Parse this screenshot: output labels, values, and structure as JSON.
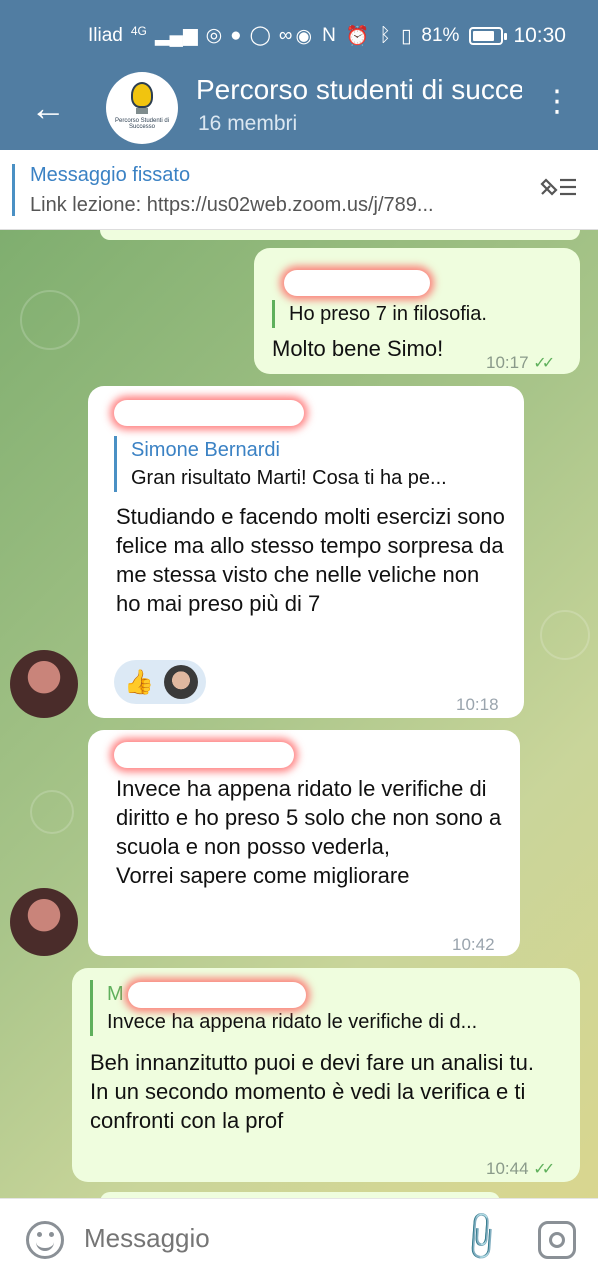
{
  "statusbar": {
    "carrier": "Iliad",
    "network": "4G",
    "battery": "81%",
    "battery_level": 0.81,
    "time": "10:30"
  },
  "header": {
    "title": "Percorso studenti di successo",
    "subtitle": "16 membri",
    "avatar_text": "Percorso Studenti di Successo"
  },
  "pinned": {
    "label": "Messaggio fissato",
    "text": "Link lezione:  https://us02web.zoom.us/j/789..."
  },
  "messages": [
    {
      "quote_text": "Ho preso 7 in filosofia.",
      "text": "Molto bene Simo!",
      "time": "10:17"
    },
    {
      "quote_name": "Simone Bernardi",
      "quote_text": "Gran risultato Marti! Cosa ti ha pe...",
      "text": "Studiando e facendo molti esercizi sono felice ma allo stesso tempo sorpresa da me stessa visto che nelle veliche non ho mai preso più di 7",
      "time": "10:18",
      "reaction": "👍"
    },
    {
      "text": "Invece ha appena ridato le verifiche di diritto e ho preso 5 solo che non sono a scuola e non posso vederla,\nVorrei sapere come migliorare",
      "time": "10:42"
    },
    {
      "quote_name_initial": "M",
      "quote_text": "Invece ha appena ridato le verifiche di d...",
      "text": "Beh innanzitutto puoi e devi fare un analisi tu.\nIn un secondo momento è vedi la verifica e ti confronti con la prof",
      "time": "10:44"
    }
  ],
  "input": {
    "placeholder": "Messaggio"
  },
  "colors": {
    "header": "#517da2",
    "accent": "#3b82c4",
    "outgoing_bubble": "#effdde",
    "read_ticks": "#5fb05c"
  }
}
